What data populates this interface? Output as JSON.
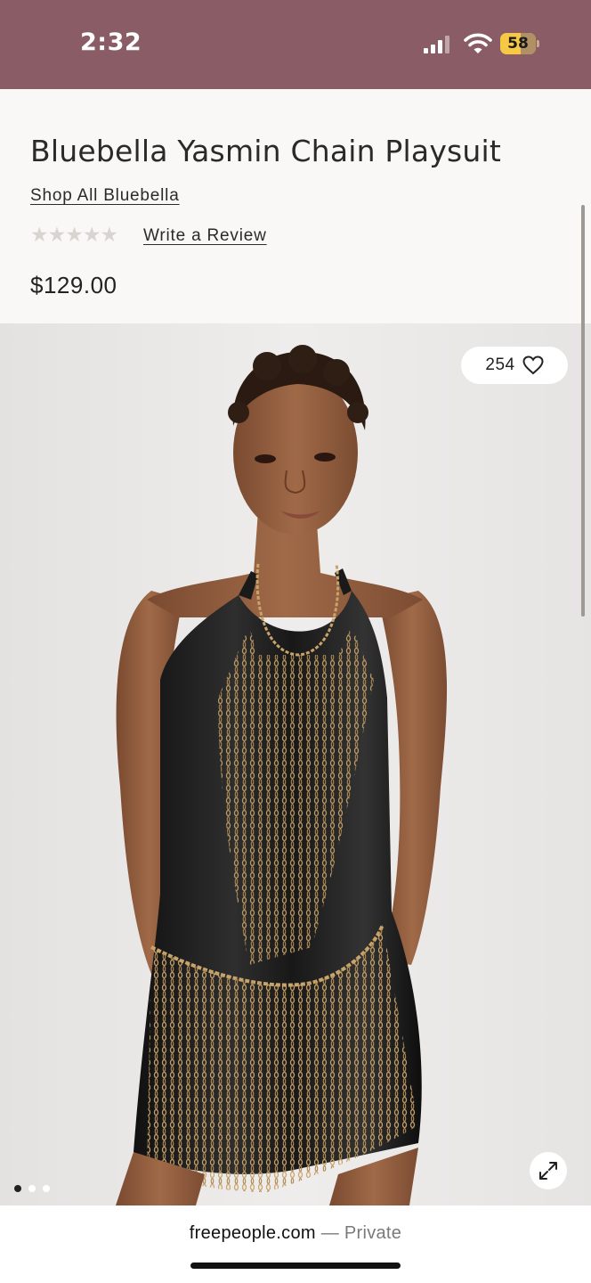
{
  "status_bar": {
    "time": "2:32",
    "battery": "58",
    "battery_level": 0.58,
    "background_color": "#8a5d66"
  },
  "product": {
    "title": "Bluebella Yasmin Chain Playsuit",
    "shop_all_link": "Shop All Bluebella",
    "rating_stars": "★★★★★",
    "rating_value": 0,
    "write_review_link": "Write a Review",
    "price": "$129.00"
  },
  "gallery": {
    "like_count": "254",
    "heart_icon": "heart-outline-icon",
    "expand_icon": "expand-arrows-icon",
    "image_count": 3,
    "active_image_index": 0
  },
  "browser": {
    "domain": "freepeople.com",
    "mode_label": "— Private"
  }
}
